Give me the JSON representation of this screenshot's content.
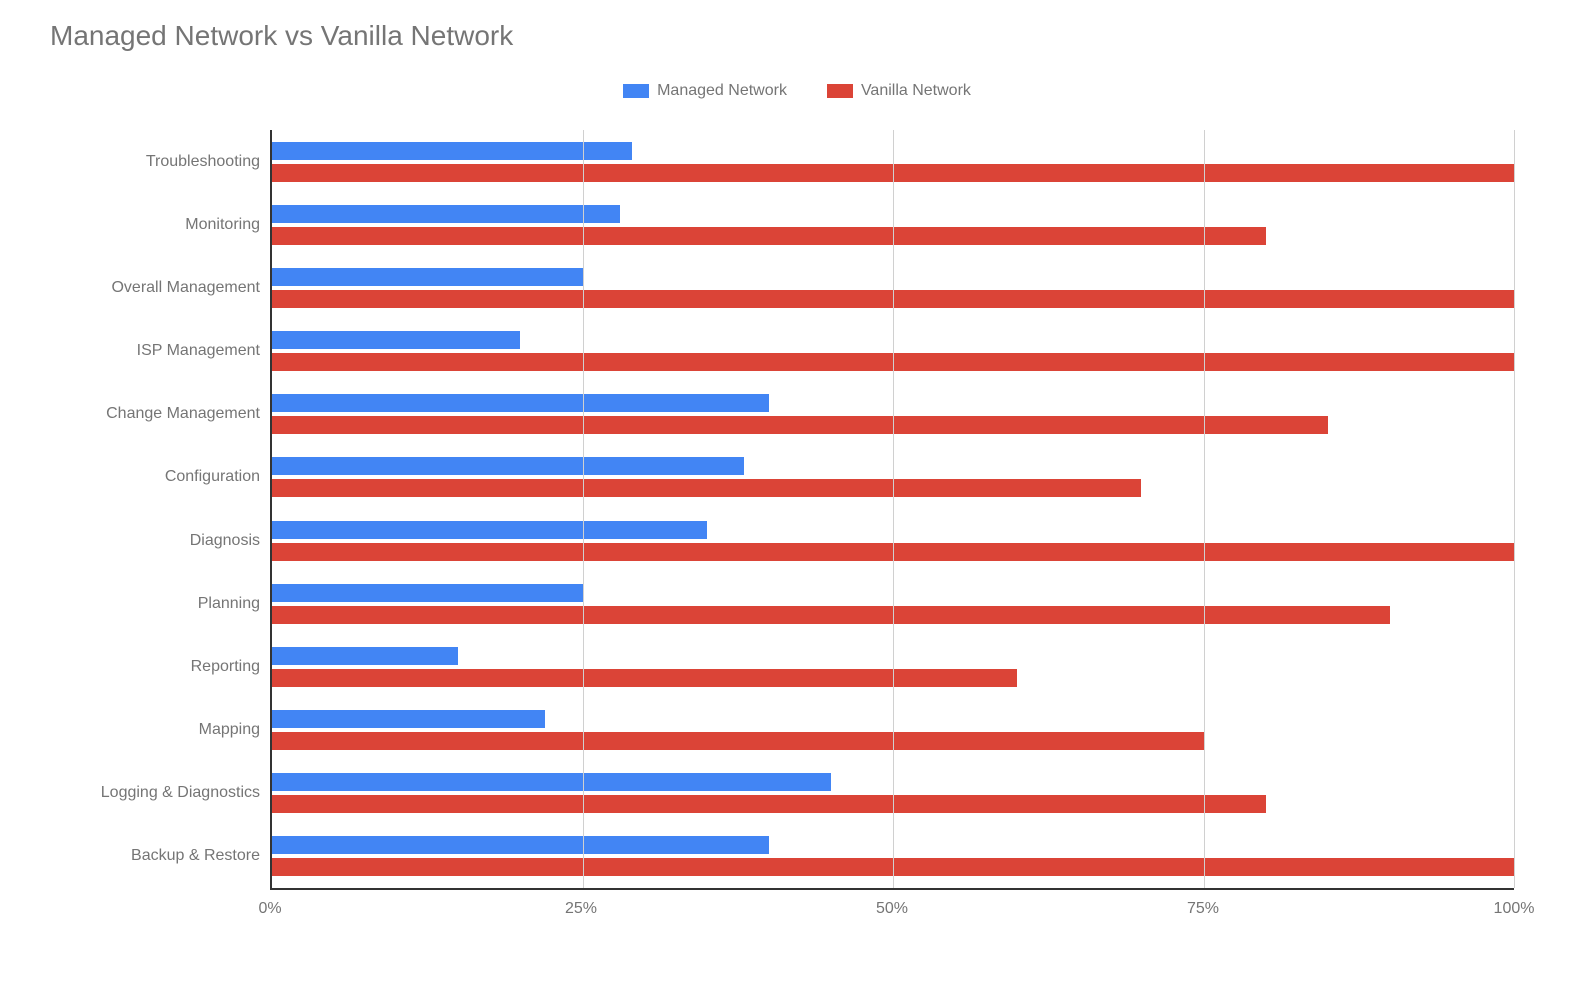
{
  "chart_data": {
    "type": "bar",
    "orientation": "horizontal",
    "title": "Managed Network vs Vanilla Network",
    "xlabel": "",
    "ylabel": "",
    "xlim": [
      0,
      100
    ],
    "xticks": [
      0,
      25,
      50,
      75,
      100
    ],
    "xtick_labels": [
      "0%",
      "25%",
      "50%",
      "75%",
      "100%"
    ],
    "categories": [
      "Troubleshooting",
      "Monitoring",
      "Overall Management",
      "ISP Management",
      "Change Management",
      "Configuration",
      "Diagnosis",
      "Planning",
      "Reporting",
      "Mapping",
      "Logging & Diagnostics",
      "Backup & Restore"
    ],
    "series": [
      {
        "name": "Managed Network",
        "color": "#4285F4",
        "values": [
          29,
          28,
          25,
          20,
          40,
          38,
          35,
          25,
          15,
          22,
          45,
          40
        ]
      },
      {
        "name": "Vanilla Network",
        "color": "#DB4437",
        "values": [
          100,
          80,
          100,
          100,
          85,
          70,
          100,
          90,
          60,
          75,
          80,
          100
        ]
      }
    ],
    "legend_position": "top",
    "grid": true
  }
}
